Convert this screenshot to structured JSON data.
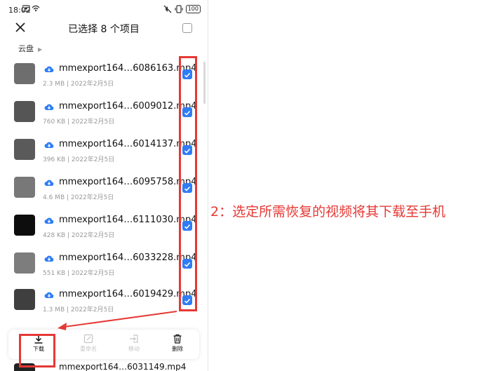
{
  "status_bar": {
    "time": "18:02",
    "battery": "100"
  },
  "header": {
    "title": "已选择 8 个项目"
  },
  "breadcrumb": {
    "location": "云盘"
  },
  "files": [
    {
      "name": "mmexport164…6086163.mp4",
      "meta": "2.3 MB | 2022年2月5日",
      "thumb_color": "#6e6e6e",
      "checked": true
    },
    {
      "name": "mmexport164…6009012.mp4",
      "meta": "760 KB | 2022年2月5日",
      "thumb_color": "#555555",
      "checked": true
    },
    {
      "name": "mmexport164…6014137.mp4",
      "meta": "396 KB | 2022年2月5日",
      "thumb_color": "#5a5a5a",
      "checked": true
    },
    {
      "name": "mmexport164…6095758.mp4",
      "meta": "4.6 MB | 2022年2月5日",
      "thumb_color": "#787878",
      "checked": true
    },
    {
      "name": "mmexport164…6111030.mp4",
      "meta": "428 KB | 2022年2月5日",
      "thumb_color": "#0d0d0d",
      "checked": true
    },
    {
      "name": "mmexport164…6033228.mp4",
      "meta": "551 KB | 2022年2月5日",
      "thumb_color": "#7d7d7d",
      "checked": true
    },
    {
      "name": "mmexport164…6019429.mp4",
      "meta": "1.3 MB | 2022年2月5日",
      "thumb_color": "#3f3f3f",
      "checked": true
    }
  ],
  "partial_file": {
    "name": "mmexport164…6031149.mp4"
  },
  "actions": {
    "download": "下载",
    "rename": "重命名",
    "move": "移动",
    "delete": "删除"
  },
  "annotation": {
    "text": "2：选定所需恢复的视频将其下载至手机"
  },
  "colors": {
    "accent": "#2f7df6",
    "highlight": "#e53935"
  }
}
